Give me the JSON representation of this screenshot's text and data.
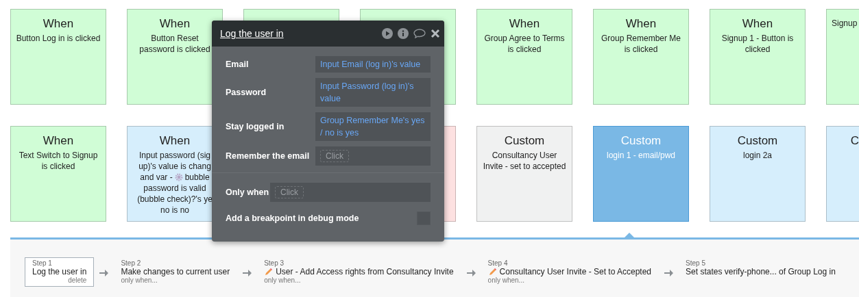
{
  "canvas": {
    "rows": [
      {
        "cards": [
          {
            "title": "When",
            "lines": [
              "Button Log in is clicked"
            ],
            "color": "#d0fdd6",
            "selected": false
          },
          {
            "title": "When",
            "lines": [
              "Button Reset",
              "password is clicked"
            ],
            "color": "#d0fdd6",
            "selected": false
          },
          {
            "color": "#d0fdd6",
            "selected": false
          },
          {
            "color": "#d0fdd6",
            "selected": false
          },
          {
            "title": "When",
            "lines": [
              "Group Agree to Terms",
              "is clicked"
            ],
            "color": "#d0fdd6",
            "selected": false
          },
          {
            "title": "When",
            "lines": [
              "Group Remember Me",
              "is clicked"
            ],
            "color": "#d0fdd6",
            "selected": false
          },
          {
            "title": "When",
            "lines": [
              "Signup 1 - Button is",
              "clicked"
            ],
            "color": "#d0fdd6",
            "selected": false
          },
          {
            "lines": [
              "Signup"
            ],
            "color": "#d0fdd6",
            "selected": false
          }
        ]
      },
      {
        "left": [
          {
            "title": "When",
            "lines": [
              "Text Switch to Signup",
              "is clicked"
            ],
            "color": "#d0fdd6",
            "selected": false
          },
          {
            "title": "When",
            "lines": [
              "Input password (sig",
              "up)'s value is chang",
              {
                "before": "and var -",
                "after": "bubble"
              },
              "password is valid",
              "(bubble check)?'s ye",
              "no is no"
            ],
            "color": "#d6eefc",
            "selected": false
          }
        ],
        "right": [
          {
            "color": "#fde1e1",
            "selected": false
          },
          {
            "title": "Custom",
            "lines": [
              "Consultancy User",
              "Invite - set to accepted"
            ],
            "color": "#f0f1f1",
            "selected": false
          },
          {
            "title": "Custom",
            "lines": [
              "login 1 - email/pwd"
            ],
            "color": "#7ab8e5",
            "selected": true
          },
          {
            "title": "Custom",
            "lines": [
              "login 2a"
            ],
            "color": "#d6eefc",
            "selected": false
          },
          {
            "title": "C",
            "color": "#d6eefc",
            "selected": false
          }
        ]
      }
    ]
  },
  "popup": {
    "title": "Log the user in",
    "fields": [
      {
        "label": "Email",
        "kind": "value",
        "value": "Input Email (log in)'s value"
      },
      {
        "label": "Password",
        "kind": "value",
        "value": "Input Password (log in)'s value"
      },
      {
        "label": "Stay logged in",
        "kind": "value",
        "value": "Group Remember Me's yes / no is yes"
      },
      {
        "label": "Remember the email",
        "kind": "click",
        "value": "Click"
      }
    ],
    "only_when": {
      "label": "Only when",
      "value": "Click"
    },
    "breakpoint": {
      "label": "Add a breakpoint in debug mode",
      "checked": false
    }
  },
  "steps": [
    {
      "label": "Step 1",
      "title": "Log the user in",
      "kind": "plain",
      "selected": true,
      "action": "delete"
    },
    {
      "label": "Step 2",
      "title": "Make changes to current user",
      "kind": "plain",
      "selected": false,
      "note": "only when..."
    },
    {
      "label": "Step 3",
      "title": "User - Add Access rights from Consultancy Invite",
      "kind": "edit",
      "selected": false,
      "note": "only when..."
    },
    {
      "label": "Step 4",
      "title": "Consultancy User Invite - Set to Accepted",
      "kind": "edit",
      "selected": false,
      "note": "only when..."
    },
    {
      "label": "Step 5",
      "title": "Set states verify-phone... of Group Log in",
      "kind": "plain",
      "selected": false
    }
  ]
}
